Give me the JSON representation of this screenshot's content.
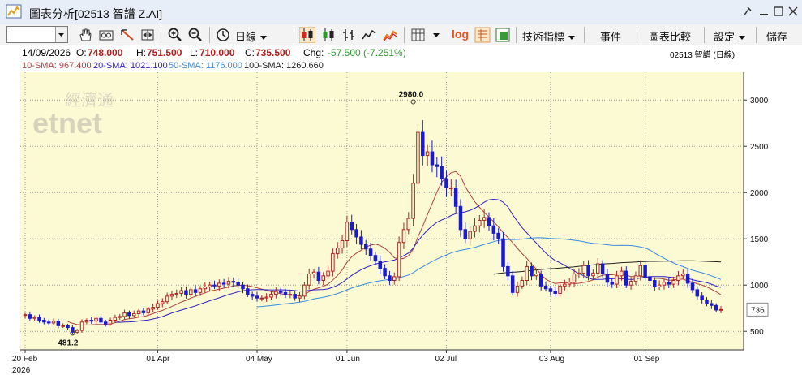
{
  "window": {
    "title": "圖表分析[02513 智譜 Z.AI]"
  },
  "toolbar": {
    "period_label": "日線",
    "log_label": "log",
    "indicators_label": "技術指標",
    "events_label": "事件",
    "compare_label": "圖表比較",
    "settings_label": "設定",
    "save_label": "儲存",
    "stock_input_value": ""
  },
  "quote": {
    "date": "14/09/2026",
    "open_label": "O:",
    "open": "748.000",
    "high_label": "H:",
    "high": "751.500",
    "low_label": "L:",
    "low": "710.000",
    "close_label": "C:",
    "close": "735.500",
    "chg_label": "Chg:",
    "chg": "-57.500 (-7.251%)",
    "symbol_caption": "02513  智譜 (日線)"
  },
  "sma": {
    "sma10": "10-SMA: 967.400",
    "sma20": "20-SMA: 1021.100",
    "sma50": "50-SMA: 1176.000",
    "sma100": "100-SMA: 1260.660"
  },
  "colors": {
    "chart_bg": "#fcfad2",
    "up_candle": "#b02222",
    "down_candle": "#1a1ad0",
    "sma10": "#b04040",
    "sma20": "#3020c0",
    "sma50": "#3b8be0",
    "sma100": "#202020",
    "chg": "#2e9c2e"
  },
  "watermark": {
    "line1": "經濟通",
    "line2": "etnet"
  },
  "chart_data": {
    "type": "candlestick",
    "y_axis": {
      "ticks": [
        500,
        1000,
        1500,
        2000,
        2500,
        3000
      ],
      "ylim": [
        300,
        3300
      ],
      "position": "right"
    },
    "x_axis": {
      "ticks": [
        {
          "label": "20 Feb",
          "sublabel": "2026",
          "index": 0
        },
        {
          "label": "01 Apr",
          "index": 28
        },
        {
          "label": "04 May",
          "index": 49
        },
        {
          "label": "01 Jun",
          "index": 68
        },
        {
          "label": "02 Jul",
          "index": 89
        },
        {
          "label": "03 Aug",
          "index": 111
        },
        {
          "label": "01 Sep",
          "index": 131
        }
      ]
    },
    "grid": true,
    "last_price_label": "736",
    "annotations": [
      {
        "text": "2980.0",
        "index": 82,
        "value": 2980
      },
      {
        "text": "481.2",
        "index": 10,
        "value": 481.2
      }
    ],
    "closes": [
      680,
      640,
      650,
      620,
      600,
      590,
      610,
      560,
      560,
      540,
      490,
      510,
      600,
      620,
      610,
      640,
      600,
      580,
      620,
      650,
      660,
      700,
      670,
      690,
      720,
      700,
      740,
      760,
      800,
      820,
      880,
      900,
      910,
      940,
      900,
      950,
      920,
      960,
      980,
      1000,
      990,
      1020,
      1010,
      1040,
      1030,
      1000,
      960,
      900,
      880,
      860,
      860,
      870,
      900,
      930,
      920,
      900,
      900,
      860,
      880,
      1000,
      1120,
      1140,
      1050,
      1100,
      1150,
      1340,
      1400,
      1480,
      1680,
      1600,
      1520,
      1440,
      1390,
      1320,
      1260,
      1180,
      1100,
      1050,
      1090,
      1460,
      1600,
      1720,
      2100,
      2650,
      2400,
      2440,
      2300,
      2280,
      2150,
      2050,
      2050,
      1850,
      1600,
      1500,
      1580,
      1640,
      1700,
      1730,
      1640,
      1560,
      1500,
      1200,
      1100,
      920,
      990,
      1050,
      1200,
      1100,
      1120,
      990,
      960,
      930,
      910,
      990,
      1010,
      1030,
      1120,
      1130,
      1210,
      1100,
      1130,
      1230,
      1120,
      1030,
      1010,
      1100,
      1150,
      1000,
      1040,
      1100,
      1210,
      1090,
      1050,
      980,
      1000,
      1030,
      1010,
      1050,
      1100,
      1120,
      1020,
      950,
      880,
      840,
      800,
      780,
      730,
      735.5
    ],
    "series": [
      {
        "name": "10-SMA",
        "value": 967.4
      },
      {
        "name": "20-SMA",
        "value": 1021.1
      },
      {
        "name": "50-SMA",
        "value": 1176.0
      },
      {
        "name": "100-SMA",
        "value": 1260.66
      }
    ]
  }
}
